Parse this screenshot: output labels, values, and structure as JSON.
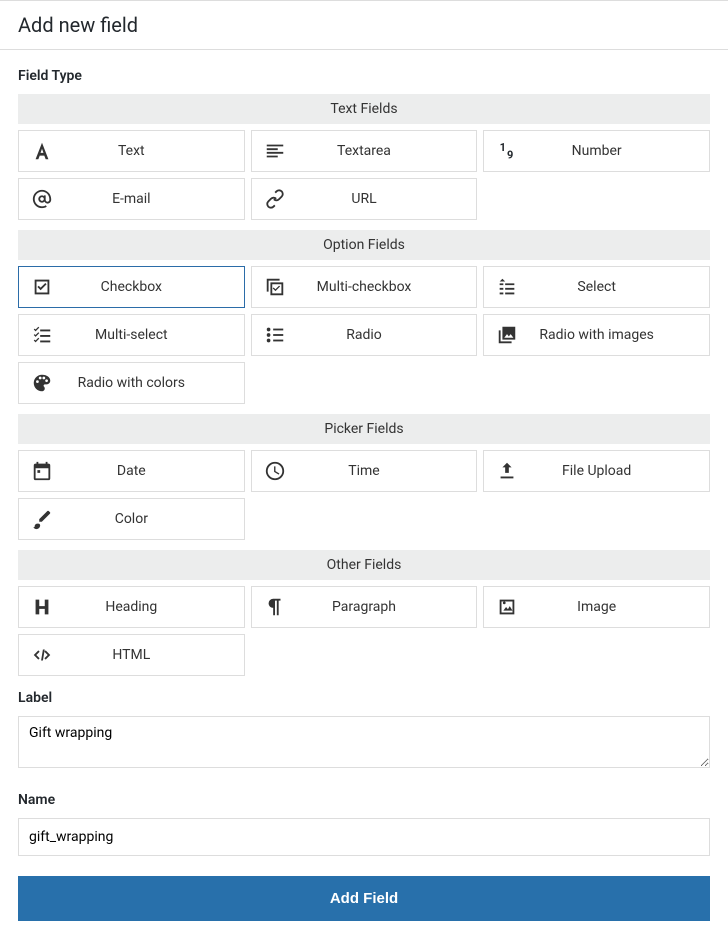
{
  "page_title": "Add new field",
  "field_type_label": "Field Type",
  "sections": [
    {
      "title": "Text Fields",
      "items": [
        {
          "key": "text",
          "label": "Text",
          "icon": "font-icon",
          "selected": false
        },
        {
          "key": "textarea",
          "label": "Textarea",
          "icon": "align-left-icon",
          "selected": false
        },
        {
          "key": "number",
          "label": "Number",
          "icon": "number-icon",
          "selected": false
        },
        {
          "key": "email",
          "label": "E-mail",
          "icon": "at-icon",
          "selected": false
        },
        {
          "key": "url",
          "label": "URL",
          "icon": "link-icon",
          "selected": false
        }
      ]
    },
    {
      "title": "Option Fields",
      "items": [
        {
          "key": "checkbox",
          "label": "Checkbox",
          "icon": "checkbox-icon",
          "selected": true
        },
        {
          "key": "multi-checkbox",
          "label": "Multi-checkbox",
          "icon": "multi-checkbox-icon",
          "selected": false
        },
        {
          "key": "select",
          "label": "Select",
          "icon": "select-icon",
          "selected": false
        },
        {
          "key": "multi-select",
          "label": "Multi-select",
          "icon": "multi-select-icon",
          "selected": false
        },
        {
          "key": "radio",
          "label": "Radio",
          "icon": "radio-icon",
          "selected": false
        },
        {
          "key": "radio-images",
          "label": "Radio with images",
          "icon": "images-icon",
          "selected": false
        },
        {
          "key": "radio-colors",
          "label": "Radio with colors",
          "icon": "palette-icon",
          "selected": false
        }
      ]
    },
    {
      "title": "Picker Fields",
      "items": [
        {
          "key": "date",
          "label": "Date",
          "icon": "calendar-icon",
          "selected": false
        },
        {
          "key": "time",
          "label": "Time",
          "icon": "clock-icon",
          "selected": false
        },
        {
          "key": "file-upload",
          "label": "File Upload",
          "icon": "upload-icon",
          "selected": false
        },
        {
          "key": "color",
          "label": "Color",
          "icon": "brush-icon",
          "selected": false
        }
      ]
    },
    {
      "title": "Other Fields",
      "items": [
        {
          "key": "heading",
          "label": "Heading",
          "icon": "heading-icon",
          "selected": false
        },
        {
          "key": "paragraph",
          "label": "Paragraph",
          "icon": "pilcrow-icon",
          "selected": false
        },
        {
          "key": "image",
          "label": "Image",
          "icon": "image-icon",
          "selected": false
        },
        {
          "key": "html",
          "label": "HTML",
          "icon": "code-icon",
          "selected": false
        }
      ]
    }
  ],
  "label_field": {
    "label": "Label",
    "value": "Gift wrapping"
  },
  "name_field": {
    "label": "Name",
    "value": "gift_wrapping"
  },
  "submit_label": "Add Field"
}
